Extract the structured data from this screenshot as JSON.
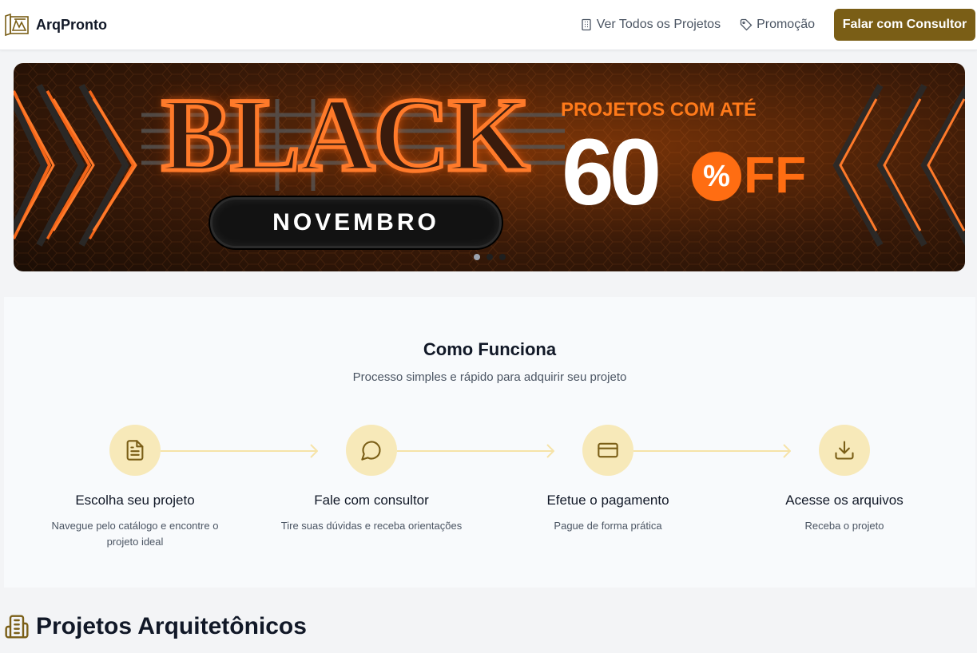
{
  "header": {
    "brand": "ArqPronto",
    "nav": {
      "all_projects": "Ver Todos os Projetos",
      "promo": "Promoção",
      "cta": "Falar com Consultor"
    }
  },
  "banner": {
    "headline": "BLACK",
    "subheadline": "NOVEMBRO",
    "promo_line": "PROJETOS COM ATÉ",
    "discount_number": "60",
    "discount_percent": "%",
    "discount_suffix": "FF",
    "slides_count": 3,
    "active_slide": 1
  },
  "how_it_works": {
    "title": "Como Funciona",
    "subtitle": "Processo simples e rápido para adquirir seu projeto",
    "steps": [
      {
        "icon": "document-icon",
        "title": "Escolha seu projeto",
        "desc": "Navegue pelo catálogo e encontre o projeto ideal"
      },
      {
        "icon": "chat-icon",
        "title": "Fale com consultor",
        "desc": "Tire suas dúvidas e receba orientações"
      },
      {
        "icon": "credit-card-icon",
        "title": "Efetue o pagamento",
        "desc": "Pague de forma prática"
      },
      {
        "icon": "download-icon",
        "title": "Acesse os arquivos",
        "desc": "Receba o projeto"
      }
    ]
  },
  "projects_section": {
    "title": "Projetos Arquitetônicos"
  },
  "colors": {
    "accent": "#7a5e16",
    "step_circle": "#f7e9b9",
    "banner_orange": "#ff6d12"
  }
}
